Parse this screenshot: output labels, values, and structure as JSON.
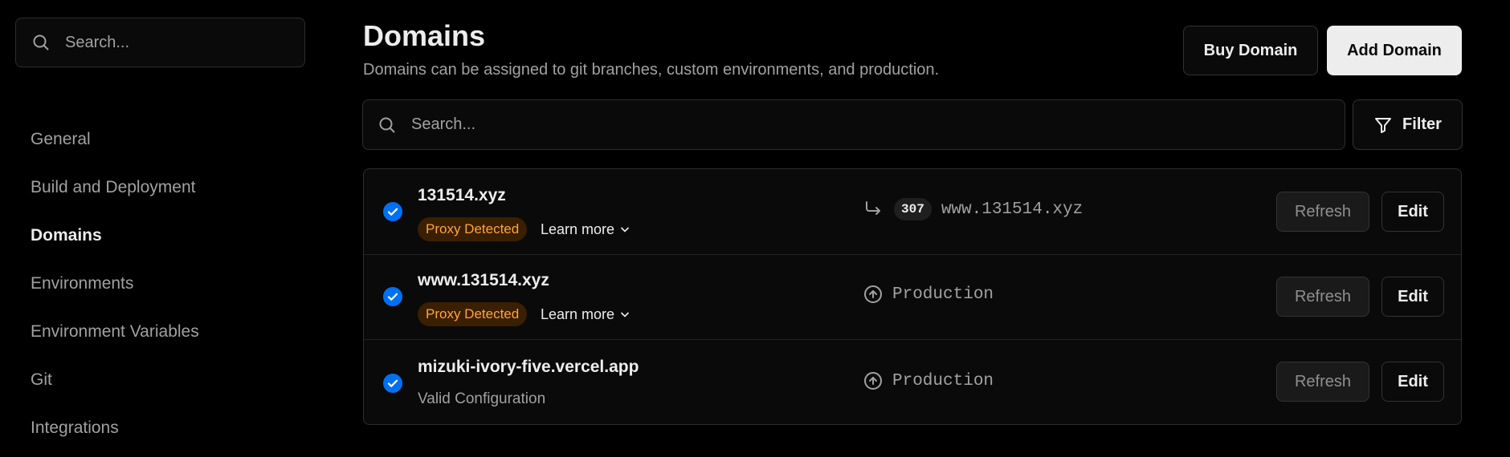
{
  "sidebar": {
    "search_placeholder": "Search...",
    "items": [
      {
        "label": "General",
        "active": false
      },
      {
        "label": "Build and Deployment",
        "active": false
      },
      {
        "label": "Domains",
        "active": true
      },
      {
        "label": "Environments",
        "active": false
      },
      {
        "label": "Environment Variables",
        "active": false
      },
      {
        "label": "Git",
        "active": false
      },
      {
        "label": "Integrations",
        "active": false
      }
    ]
  },
  "header": {
    "title": "Domains",
    "subtitle": "Domains can be assigned to git branches, custom environments, and production.",
    "buy_label": "Buy Domain",
    "add_label": "Add Domain"
  },
  "search": {
    "placeholder": "Search..."
  },
  "filter": {
    "label": "Filter"
  },
  "domains": [
    {
      "name": "131514.xyz",
      "badge": "Proxy Detected",
      "learn_more": "Learn more",
      "redirect_code": "307",
      "redirect_target": "www.131514.xyz",
      "refresh_label": "Refresh",
      "edit_label": "Edit"
    },
    {
      "name": "www.131514.xyz",
      "badge": "Proxy Detected",
      "learn_more": "Learn more",
      "target": "Production",
      "refresh_label": "Refresh",
      "edit_label": "Edit"
    },
    {
      "name": "mizuki-ivory-five.vercel.app",
      "status": "Valid Configuration",
      "target": "Production",
      "refresh_label": "Refresh",
      "edit_label": "Edit"
    }
  ],
  "colors": {
    "background": "#000000",
    "check_blue": "#0070f3",
    "badge_bg": "#3a1f00",
    "badge_text": "#ffa53d",
    "primary_button": "#ededed"
  },
  "icons": {
    "search": "search-icon",
    "filter": "filter-icon",
    "check": "check-circle-icon",
    "redirect": "redirect-arrow-icon",
    "production": "arrow-up-circle-icon",
    "chevron": "chevron-down-icon"
  }
}
